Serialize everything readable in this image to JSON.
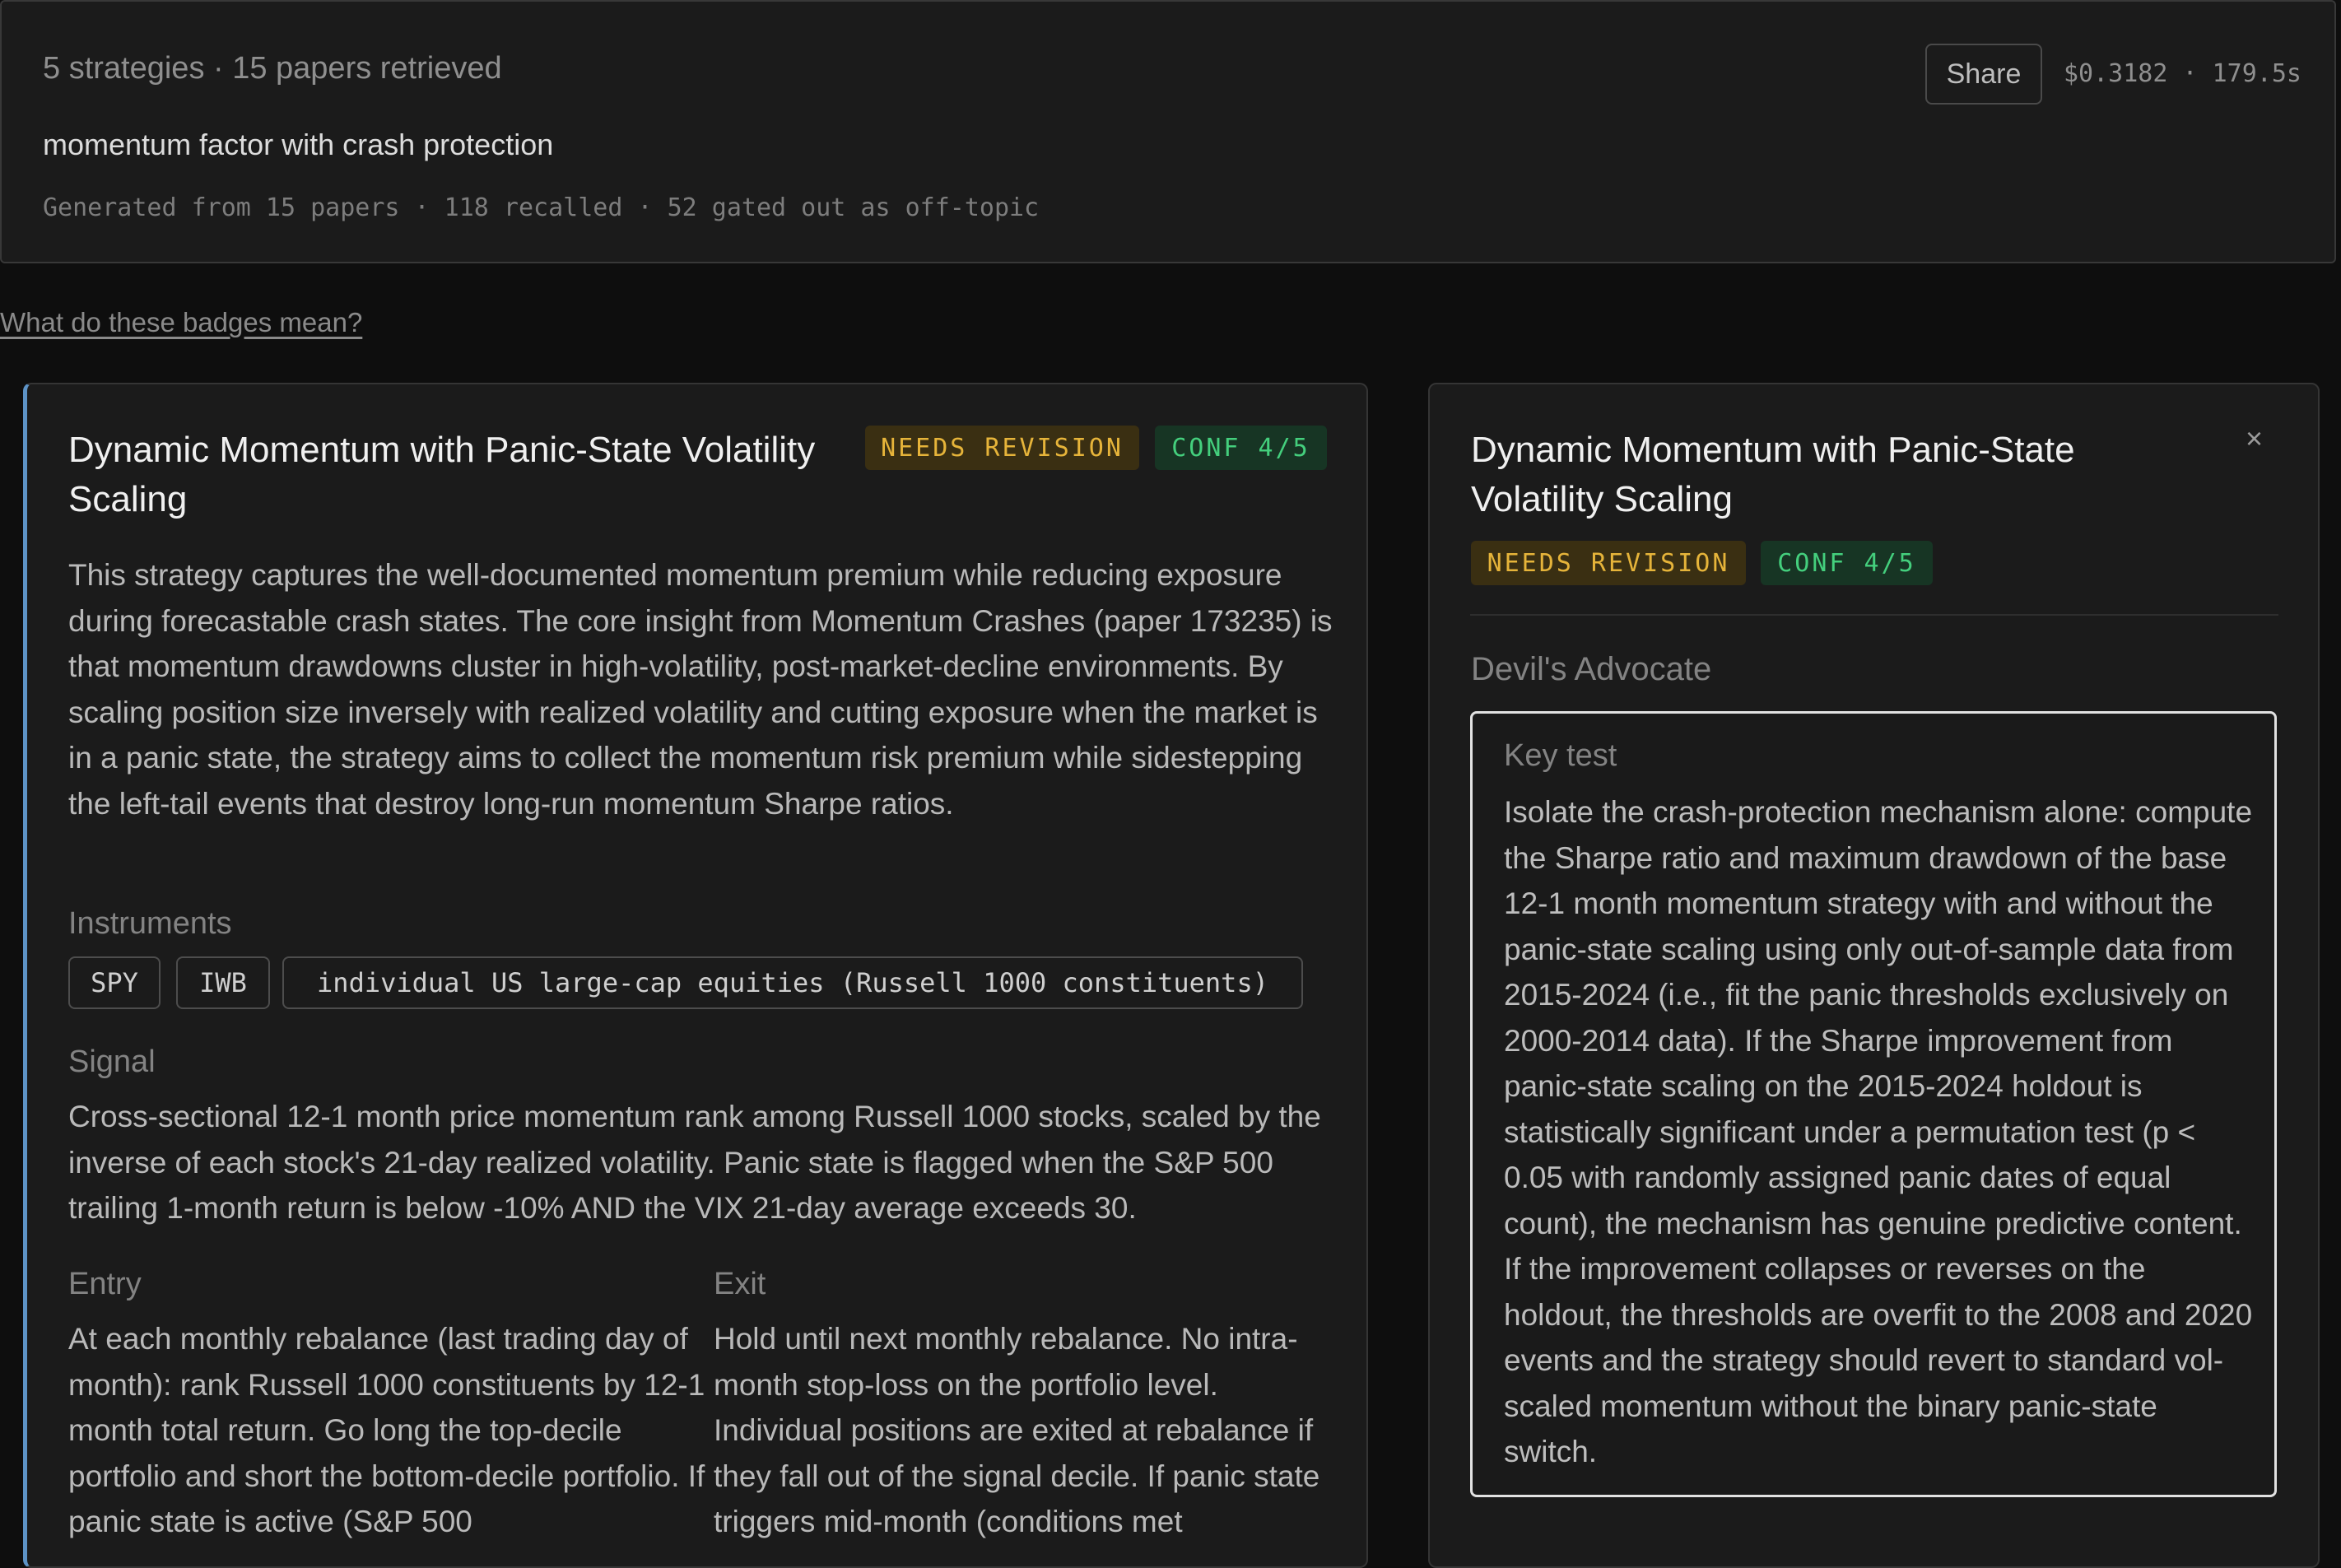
{
  "header": {
    "summary": "5 strategies · 15 papers retrieved",
    "query": "momentum factor with crash protection",
    "meta": "Generated from 15 papers · 118 recalled · 52 gated out as off-topic",
    "share_label": "Share",
    "cost": "$0.3182 · 179.5s"
  },
  "badge_help": "What do these badges mean?",
  "strategy": {
    "title": "Dynamic Momentum with Panic-State Volatility Scaling",
    "status_badge": "NEEDS REVISION",
    "conf_badge": "CONF 4/5",
    "description": "This strategy captures the well-documented momentum premium while reducing exposure during forecastable crash states. The core insight from Momentum Crashes (paper 173235) is that momentum drawdowns cluster in high-volatility, post-market-decline environments. By scaling position size inversely with realized volatility and cutting exposure when the market is in a panic state, the strategy aims to collect the momentum risk premium while sidestepping the left-tail events that destroy long-run momentum Sharpe ratios.",
    "instruments_label": "Instruments",
    "instruments": [
      "SPY",
      "IWB",
      "individual US large-cap equities (Russell 1000 constituents)"
    ],
    "signal_label": "Signal",
    "signal": "Cross-sectional 12-1 month price momentum rank among Russell 1000 stocks, scaled by the inverse of each stock's 21-day realized volatility. Panic state is flagged when the S&P 500 trailing 1-month return is below -10% AND the VIX 21-day average exceeds 30.",
    "entry_label": "Entry",
    "entry": "At each monthly rebalance (last trading day of month): rank Russell 1000 constituents by 12-1 month total return. Go long the top-decile portfolio and short the bottom-decile portfolio. If panic state is active (S&P 500",
    "exit_label": "Exit",
    "exit": "Hold until next monthly rebalance. No intra-month stop-loss on the portfolio level. Individual positions are exited at rebalance if they fall out of the signal decile. If panic state triggers mid-month (conditions met"
  },
  "detail": {
    "title": "Dynamic Momentum with Panic-State Volatility Scaling",
    "status_badge": "NEEDS REVISION",
    "conf_badge": "CONF 4/5",
    "close_icon": "×",
    "section_label": "Devil's Advocate",
    "key_test_label": "Key test",
    "key_test": "Isolate the crash-protection mechanism alone: compute the Sharpe ratio and maximum drawdown of the base 12-1 month momentum strategy with and without the panic-state scaling using only out-of-sample data from 2015-2024 (i.e., fit the panic thresholds exclusively on 2000-2014 data). If the Sharpe improvement from panic-state scaling on the 2015-2024 holdout is statistically significant under a permutation test (p < 0.05 with randomly assigned panic dates of equal count), the mechanism has genuine predictive content. If the improvement collapses or reverses on the holdout, the thresholds are overfit to the 2008 and 2020 events and the strategy should revert to standard vol-scaled momentum without the binary panic-state switch."
  },
  "colors": {
    "accent_bar": "#5d93c6",
    "needs_revision": "#e6b43a",
    "conf": "#44cf7d"
  }
}
